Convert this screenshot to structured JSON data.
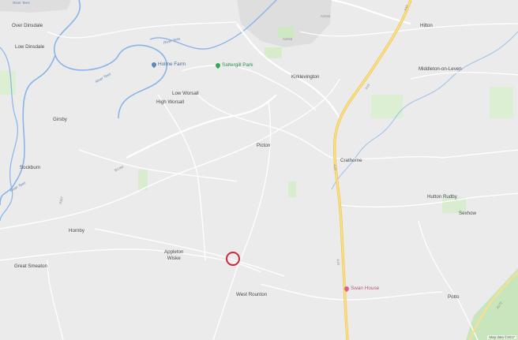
{
  "map": {
    "colors": {
      "land": "#ebebeb",
      "water": "#8ab4e8",
      "park": "#cfe8c4",
      "motorway": "#f5d46a",
      "urban": "#d9d9d9",
      "marker": "#d0263a"
    },
    "places": {
      "over_dinsdale": "Over Dinsdale",
      "low_dinsdale": "Low Dinsdale",
      "girsby": "Girsby",
      "sockburn": "Sockburn",
      "hornby": "Hornby",
      "great_smeaton": "Great Smeaton",
      "appleton_wiske": "Appleton\nWiske",
      "west_rounton": "West Rounton",
      "low_worsall": "Low Worsall",
      "high_worsall": "High Worsall",
      "kirklevington": "Kirklevington",
      "picton": "Picton",
      "crathorne": "Crathorne",
      "hilton": "Hilton",
      "middleton_on_leven": "Middleton-on-Leven",
      "hutton_rudby": "Hutton Rudby",
      "sexhow": "Sexhow",
      "potto": "Potto"
    },
    "pois": {
      "holme_farm": "Holme Farm",
      "saltergill_park": "Saltergill Park",
      "swan_house": "Swan House"
    },
    "roads": {
      "a19_a": "A19",
      "a19_b": "A19",
      "a19_c": "A19",
      "a19_d": "A19",
      "a1044": "A1044",
      "b1264": "B1264",
      "a172": "A172",
      "a167": "A167",
      "a1044_b": "A1044"
    },
    "rivers": {
      "r1": "River Tees",
      "r2": "River Tees",
      "r3": "River Tees",
      "r4": "River Tees"
    },
    "credit": "Map data ©2017"
  }
}
